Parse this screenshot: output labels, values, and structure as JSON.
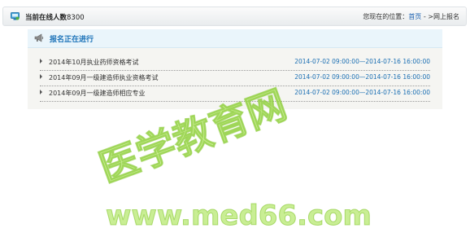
{
  "header": {
    "online_label": "当前在线人数",
    "online_count": "8300",
    "location_prefix": "您现在的位置：",
    "breadcrumb_home": "首页",
    "breadcrumb_separator": " - >",
    "breadcrumb_current": "网上报名"
  },
  "panel": {
    "title": "报名正在进行",
    "items": [
      {
        "name": "2014年10月执业药师资格考试",
        "period": "2014-07-02 09:00:00—2014-07-16 16:00:00"
      },
      {
        "name": "2014年09月一级建造师执业资格考试",
        "period": "2014-07-02 09:00:00—2014-07-16 16:00:00"
      },
      {
        "name": "2014年09月一级建造师相应专业",
        "period": "2014-07-02 09:00:00—2014-07-16 16:00:00"
      }
    ]
  },
  "watermark": {
    "brand_text": "医学教育网",
    "url_text": "www.med66.com",
    "color": "#9ce040"
  },
  "icons": {
    "online": "online-users-icon",
    "announcement": "megaphone-icon",
    "bullet": "bullet-arrow-icon"
  }
}
